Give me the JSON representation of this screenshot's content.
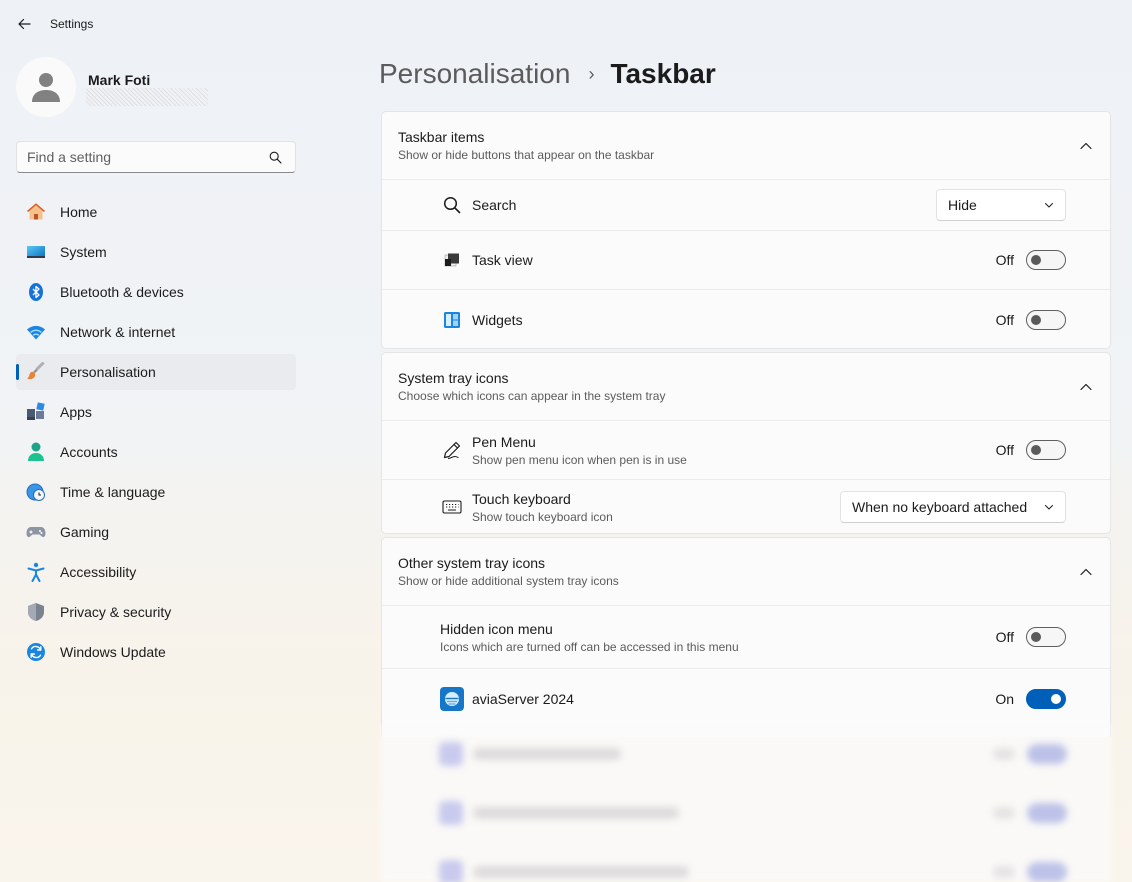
{
  "window": {
    "title": "Settings"
  },
  "profile": {
    "name": "Mark Foti"
  },
  "search": {
    "placeholder": "Find a setting"
  },
  "sidebar": {
    "items": [
      {
        "label": "Home",
        "icon": "home-icon"
      },
      {
        "label": "System",
        "icon": "system-icon"
      },
      {
        "label": "Bluetooth & devices",
        "icon": "bluetooth-icon"
      },
      {
        "label": "Network & internet",
        "icon": "wifi-icon"
      },
      {
        "label": "Personalisation",
        "icon": "brush-icon",
        "active": true
      },
      {
        "label": "Apps",
        "icon": "apps-icon"
      },
      {
        "label": "Accounts",
        "icon": "accounts-icon"
      },
      {
        "label": "Time & language",
        "icon": "clock-globe-icon"
      },
      {
        "label": "Gaming",
        "icon": "gamepad-icon"
      },
      {
        "label": "Accessibility",
        "icon": "accessibility-icon"
      },
      {
        "label": "Privacy & security",
        "icon": "shield-icon"
      },
      {
        "label": "Windows Update",
        "icon": "update-icon"
      }
    ]
  },
  "breadcrumb": {
    "parent": "Personalisation",
    "separator": "›",
    "current": "Taskbar"
  },
  "taskbar_items": {
    "title": "Taskbar items",
    "subtitle": "Show or hide buttons that appear on the taskbar",
    "search": {
      "label": "Search",
      "value": "Hide"
    },
    "task_view": {
      "label": "Task view",
      "state": "Off"
    },
    "widgets": {
      "label": "Widgets",
      "state": "Off"
    }
  },
  "system_tray": {
    "title": "System tray icons",
    "subtitle": "Choose which icons can appear in the system tray",
    "pen_menu": {
      "label": "Pen Menu",
      "subtitle": "Show pen menu icon when pen is in use",
      "state": "Off"
    },
    "touch_keyboard": {
      "label": "Touch keyboard",
      "subtitle": "Show touch keyboard icon",
      "value": "When no keyboard attached"
    }
  },
  "other_tray": {
    "title": "Other system tray icons",
    "subtitle": "Show or hide additional system tray icons",
    "hidden_menu": {
      "label": "Hidden icon menu",
      "subtitle": "Icons which are turned off can be accessed in this menu",
      "state": "Off"
    },
    "avia": {
      "label": "aviaServer 2024",
      "state": "On"
    }
  },
  "colors": {
    "accent": "#005fb8"
  }
}
